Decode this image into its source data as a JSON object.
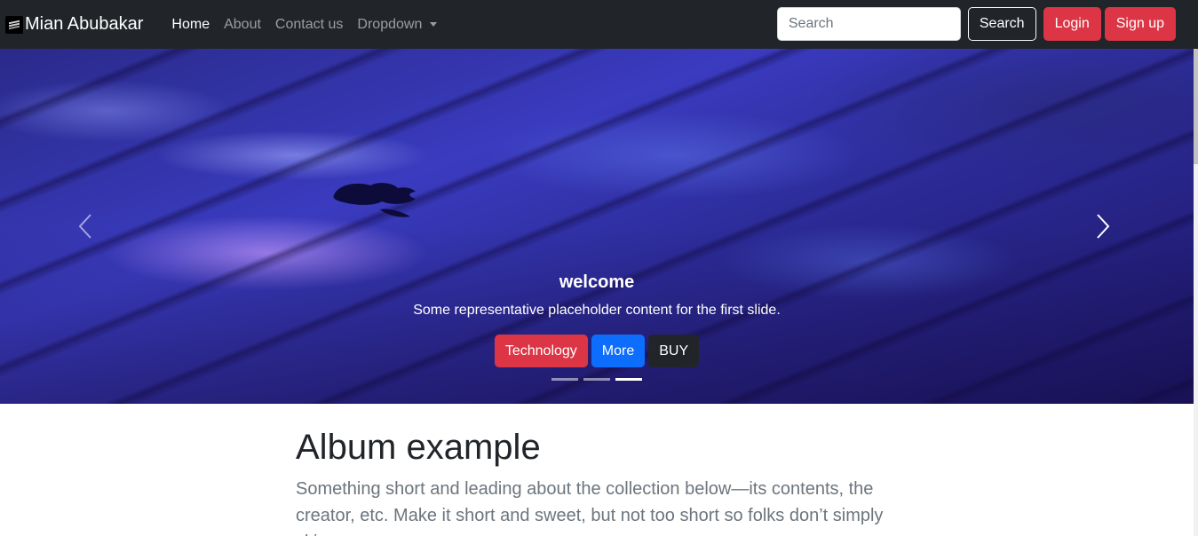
{
  "navbar": {
    "brand": "Mian Abubakar",
    "links": [
      {
        "label": "Home",
        "active": true
      },
      {
        "label": "About",
        "active": false
      },
      {
        "label": "Contact us",
        "active": false
      },
      {
        "label": "Dropdown",
        "active": false
      }
    ],
    "search_placeholder": "Search",
    "search_button": "Search",
    "login_button": "Login",
    "signup_button": "Sign up"
  },
  "carousel": {
    "caption_title": "welcome",
    "caption_text": "Some representative placeholder content for the first slide.",
    "buttons": [
      "Technology",
      "More",
      "BUY"
    ],
    "slide_count": 3,
    "active_slide": 3,
    "image_icon": "apple-logo-icon"
  },
  "album": {
    "title": "Album example",
    "lead": "Something short and leading about the collection below—its contents, the creator, etc. Make it short and sweet, but not too short so folks don’t simply skip"
  },
  "colors": {
    "navbar_bg": "#212529",
    "danger": "#dc3545",
    "primary": "#0d6efd",
    "dark": "#212529"
  }
}
